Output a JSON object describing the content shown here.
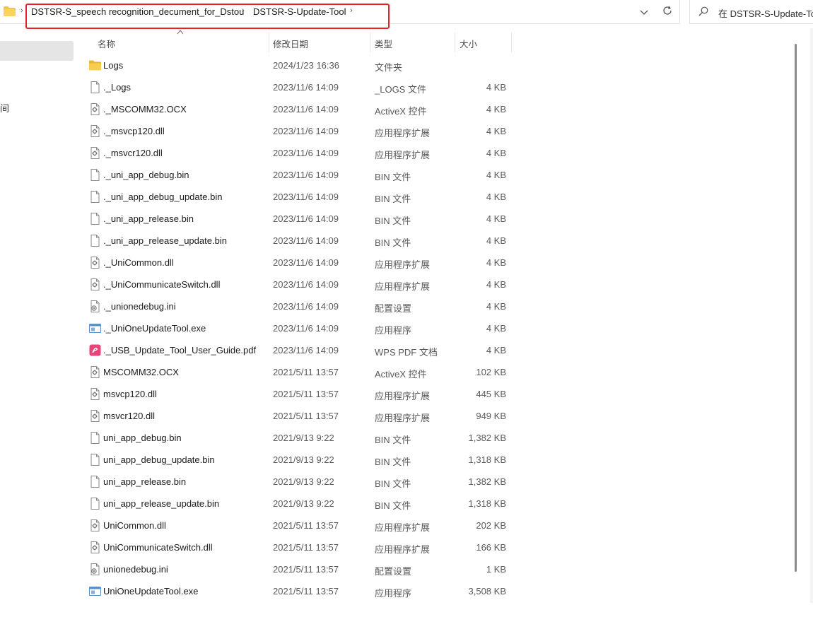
{
  "address": {
    "crumbs": [
      "DSTSR-S_speech recognition_decument_for_Dstou",
      "DSTSR-S-Update-Tool"
    ],
    "separator": "›"
  },
  "search": {
    "placeholder": "在 DSTSR-S-Update-Tool"
  },
  "nav": {
    "fragment": "间"
  },
  "columns": {
    "name": "名称",
    "date": "修改日期",
    "type": "类型",
    "size": "大小"
  },
  "colors": {
    "highlight": "#e8202a",
    "folder": "#f4c542",
    "pdf": "#e8447a",
    "selected": "#e5e5e5"
  },
  "rows": [
    {
      "name": "Logs",
      "date": "2024/1/23 16:36",
      "type": "文件夹",
      "size": "",
      "icon": "folder-icon"
    },
    {
      "name": "._Logs",
      "date": "2023/11/6 14:09",
      "type": "_LOGS 文件",
      "size": "4 KB",
      "icon": "file-icon"
    },
    {
      "name": "._MSCOMM32.OCX",
      "date": "2023/11/6 14:09",
      "type": "ActiveX 控件",
      "size": "4 KB",
      "icon": "dll-icon"
    },
    {
      "name": "._msvcp120.dll",
      "date": "2023/11/6 14:09",
      "type": "应用程序扩展",
      "size": "4 KB",
      "icon": "dll-icon"
    },
    {
      "name": "._msvcr120.dll",
      "date": "2023/11/6 14:09",
      "type": "应用程序扩展",
      "size": "4 KB",
      "icon": "dll-icon"
    },
    {
      "name": "._uni_app_debug.bin",
      "date": "2023/11/6 14:09",
      "type": "BIN 文件",
      "size": "4 KB",
      "icon": "file-icon"
    },
    {
      "name": "._uni_app_debug_update.bin",
      "date": "2023/11/6 14:09",
      "type": "BIN 文件",
      "size": "4 KB",
      "icon": "file-icon"
    },
    {
      "name": "._uni_app_release.bin",
      "date": "2023/11/6 14:09",
      "type": "BIN 文件",
      "size": "4 KB",
      "icon": "file-icon"
    },
    {
      "name": "._uni_app_release_update.bin",
      "date": "2023/11/6 14:09",
      "type": "BIN 文件",
      "size": "4 KB",
      "icon": "file-icon"
    },
    {
      "name": "._UniCommon.dll",
      "date": "2023/11/6 14:09",
      "type": "应用程序扩展",
      "size": "4 KB",
      "icon": "dll-icon"
    },
    {
      "name": "._UniCommunicateSwitch.dll",
      "date": "2023/11/6 14:09",
      "type": "应用程序扩展",
      "size": "4 KB",
      "icon": "dll-icon"
    },
    {
      "name": "._unionedebug.ini",
      "date": "2023/11/6 14:09",
      "type": "配置设置",
      "size": "4 KB",
      "icon": "ini-icon"
    },
    {
      "name": "._UniOneUpdateTool.exe",
      "date": "2023/11/6 14:09",
      "type": "应用程序",
      "size": "4 KB",
      "icon": "exe-icon"
    },
    {
      "name": "._USB_Update_Tool_User_Guide.pdf",
      "date": "2023/11/6 14:09",
      "type": "WPS PDF 文档",
      "size": "4 KB",
      "icon": "pdf-icon"
    },
    {
      "name": "MSCOMM32.OCX",
      "date": "2021/5/11 13:57",
      "type": "ActiveX 控件",
      "size": "102 KB",
      "icon": "dll-icon"
    },
    {
      "name": "msvcp120.dll",
      "date": "2021/5/11 13:57",
      "type": "应用程序扩展",
      "size": "445 KB",
      "icon": "dll-icon"
    },
    {
      "name": "msvcr120.dll",
      "date": "2021/5/11 13:57",
      "type": "应用程序扩展",
      "size": "949 KB",
      "icon": "dll-icon"
    },
    {
      "name": "uni_app_debug.bin",
      "date": "2021/9/13 9:22",
      "type": "BIN 文件",
      "size": "1,382 KB",
      "icon": "file-icon"
    },
    {
      "name": "uni_app_debug_update.bin",
      "date": "2021/9/13 9:22",
      "type": "BIN 文件",
      "size": "1,318 KB",
      "icon": "file-icon"
    },
    {
      "name": "uni_app_release.bin",
      "date": "2021/9/13 9:22",
      "type": "BIN 文件",
      "size": "1,382 KB",
      "icon": "file-icon"
    },
    {
      "name": "uni_app_release_update.bin",
      "date": "2021/9/13 9:22",
      "type": "BIN 文件",
      "size": "1,318 KB",
      "icon": "file-icon"
    },
    {
      "name": "UniCommon.dll",
      "date": "2021/5/11 13:57",
      "type": "应用程序扩展",
      "size": "202 KB",
      "icon": "dll-icon"
    },
    {
      "name": "UniCommunicateSwitch.dll",
      "date": "2021/5/11 13:57",
      "type": "应用程序扩展",
      "size": "166 KB",
      "icon": "dll-icon"
    },
    {
      "name": "unionedebug.ini",
      "date": "2021/5/11 13:57",
      "type": "配置设置",
      "size": "1 KB",
      "icon": "ini-icon"
    },
    {
      "name": "UniOneUpdateTool.exe",
      "date": "2021/5/11 13:57",
      "type": "应用程序",
      "size": "3,508 KB",
      "icon": "exe-icon"
    }
  ]
}
